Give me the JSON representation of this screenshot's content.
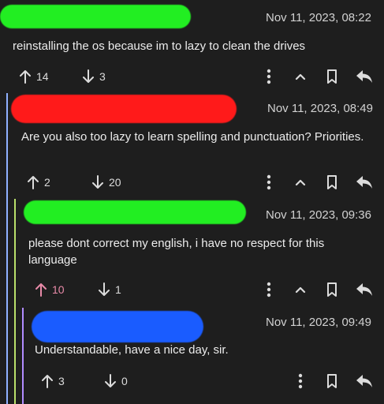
{
  "comments": [
    {
      "timestamp": "Nov 11, 2023, 08:22",
      "text": "reinstalling the os because im to lazy to clean the drives",
      "upvotes": "14",
      "downvotes": "3",
      "redaction_color": "#22ee22",
      "upvoted": false
    },
    {
      "timestamp": "Nov 11, 2023, 08:49",
      "text": "Are you also too lazy to learn spelling and punctuation? Priorities.",
      "upvotes": "2",
      "downvotes": "20",
      "redaction_color": "#ff1a1a",
      "upvoted": false
    },
    {
      "timestamp": "Nov 11, 2023, 09:36",
      "text": "please dont correct my english, i have no respect for this language",
      "upvotes": "10",
      "downvotes": "1",
      "redaction_color": "#22ee22",
      "upvoted": true
    },
    {
      "timestamp": "Nov 11, 2023, 09:49",
      "text": "Understandable, have a nice day, sir.",
      "upvotes": "3",
      "downvotes": "0",
      "redaction_color": "#1a5cff",
      "upvoted": false
    }
  ],
  "thread_colors": {
    "level1": "#8fb0ff",
    "level2": "#b9e06a",
    "level3": "#b18cff"
  },
  "icons": [
    "arrow-up-icon",
    "arrow-down-icon",
    "more-vertical-icon",
    "chevron-up-icon",
    "bookmark-icon",
    "reply-icon"
  ]
}
